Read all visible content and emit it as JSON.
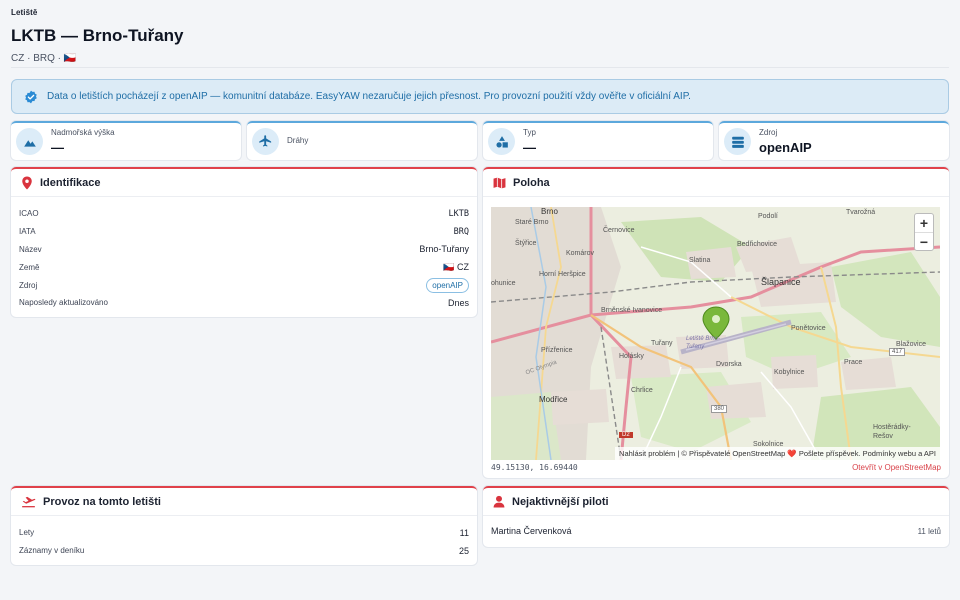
{
  "header": {
    "eyebrow": "Letiště",
    "title": "LKTB — Brno-Tuřany",
    "subtitle": "CZ · BRQ · 🇨🇿"
  },
  "notice": {
    "text": "Data o letištích pocházejí z openAIP — komunitní databáze. EasyYAW nezaručuje jejich přesnost. Pro provozní použití vždy ověřte v oficiální AIP.",
    "icon": "check-badge-icon"
  },
  "stats": [
    {
      "label": "Nadmořská výška",
      "value": "—",
      "icon": "mountain-icon"
    },
    {
      "label": "Dráhy",
      "value": "",
      "icon": "airplane-icon"
    },
    {
      "label": "Typ",
      "value": "—",
      "icon": "shapes-icon"
    },
    {
      "label": "Zdroj",
      "value": "openAIP",
      "icon": "database-icon"
    }
  ],
  "identification": {
    "title": "Identifikace",
    "rows": [
      {
        "key": "ICAO",
        "value": "LKTB"
      },
      {
        "key": "IATA",
        "value": "BRQ"
      },
      {
        "key": "Název",
        "value": "Brno-Tuřany"
      },
      {
        "key": "Země",
        "value": "🇨🇿 CZ"
      },
      {
        "key": "Zdroj",
        "value": "openAIP"
      },
      {
        "key": "Naposledy aktualizováno",
        "value": "Dnes"
      }
    ]
  },
  "location": {
    "title": "Poloha",
    "coords": "49.15130, 16.69440",
    "open_link": "Otevřít v OpenStreetMap",
    "zoom_in": "+",
    "zoom_out": "−",
    "attribution": "Nahlásit problém | © Přispěvatelé OpenStreetMap ❤️ Pošlete příspěvek. Podmínky webu a API",
    "labels": {
      "brno": "Brno",
      "stare_brno": "Staré Brno",
      "cernovice": "Černovice",
      "podoli": "Podolí",
      "tvarozna": "Tvarožná",
      "styrice": "Štýřice",
      "komarov": "Komárov",
      "bedrichovice": "Bedřichovice",
      "slatina": "Slatina",
      "horni_herspice": "Horní Heršpice",
      "slapanice": "Šlapanice",
      "ohunice": "ohunice",
      "brnenske_ivanovice": "Brněnské Ivanovice",
      "ponetovice": "Ponětovice",
      "letiste": "Letiště Brno-Tuřany",
      "prizrenice": "Přízřenice",
      "holasky": "Holásky",
      "turany": "Tuřany",
      "dvorska": "Dvorska",
      "blazovice": "Blažovice",
      "kobylnice": "Kobylnice",
      "prace": "Prace",
      "modrice": "Modřice",
      "chrlice": "Chrlice",
      "sokolnice": "Sokolnice",
      "hosteradky": "Hostěrádky-Rešov",
      "r417": "417",
      "r380": "380",
      "d2": "D2",
      "obora": "OC Olympia"
    }
  },
  "operations": {
    "title": "Provoz na tomto letišti",
    "rows": [
      {
        "key": "Lety",
        "value": "11"
      },
      {
        "key": "Záznamy v deníku",
        "value": "25"
      }
    ]
  },
  "pilots": {
    "title": "Nejaktivnější piloti",
    "rows": [
      {
        "name": "Martina Červenková",
        "count": "11 letů"
      }
    ]
  }
}
